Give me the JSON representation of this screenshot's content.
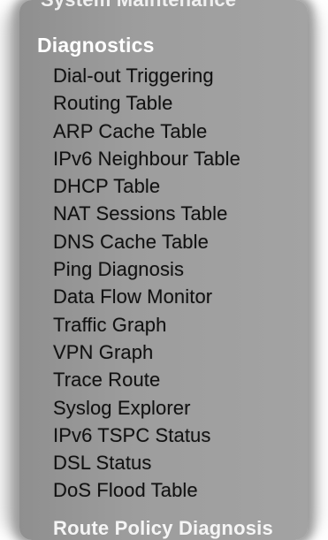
{
  "menu": {
    "section_above": "System Maintenance",
    "title": "Diagnostics",
    "items": [
      "Dial-out Triggering",
      "Routing Table",
      "ARP Cache Table",
      "IPv6 Neighbour Table",
      "DHCP Table",
      "NAT Sessions Table",
      "DNS Cache Table",
      "Ping Diagnosis",
      "Data Flow Monitor",
      "Traffic Graph",
      "VPN Graph",
      "Trace Route",
      "Syslog Explorer",
      "IPv6 TSPC Status",
      "DSL Status",
      "DoS Flood Table"
    ],
    "next_item": "Route Policy Diagnosis"
  },
  "colors": {
    "panel": "#9d9d9d",
    "text": "#111111",
    "heading": "#ffffff"
  }
}
